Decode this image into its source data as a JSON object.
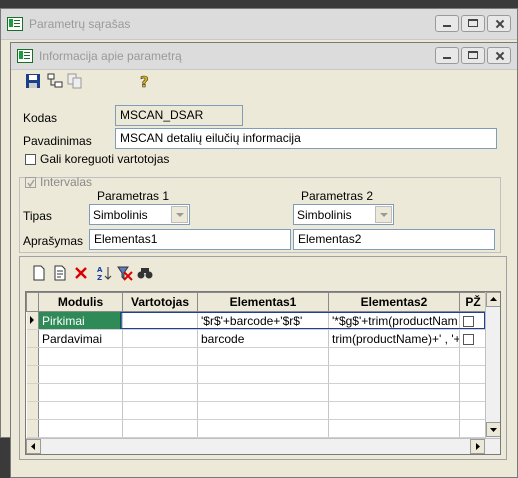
{
  "back_window": {
    "title": "Parametrų sąrašas"
  },
  "front_window": {
    "title": "Informacija apie parametrą"
  },
  "toolbar_icons": [
    "save-icon",
    "tree-icon",
    "copy-icon",
    "help-icon"
  ],
  "form": {
    "kodas_label": "Kodas",
    "kodas_value": "MSCAN_DSAR",
    "pavadinimas_label": "Pavadinimas",
    "pavadinimas_value": "MSCAN detalių eilučių informacija",
    "gali_koreguoti_label": "Gali koreguoti vartotojas",
    "intervalas_label": "Intervalas",
    "parametras1_label": "Parametras 1",
    "parametras2_label": "Parametras 2",
    "tipas_label": "Tipas",
    "tipas1_value": "Simbolinis",
    "tipas2_value": "Simbolinis",
    "aprasymas_label": "Aprašymas",
    "aprasymas1_value": "Elementas1",
    "aprasymas2_value": "Elementas2"
  },
  "grid_toolbar_icons": [
    "new-icon",
    "edit-icon",
    "delete-icon",
    "sort-az-icon",
    "filter-clear-icon",
    "find-icon"
  ],
  "grid": {
    "headers": [
      "Modulis",
      "Vartotojas",
      "Elementas1",
      "Elementas2",
      "PŽ"
    ],
    "rows": [
      {
        "modulis": "Pirkimai",
        "vartotojas": "",
        "elementas1": "'$r$'+barcode+'$r$'",
        "elementas2": "'*$g$'+trim(productNam"
      },
      {
        "modulis": "Pardavimai",
        "vartotojas": "",
        "elementas1": "barcode",
        "elementas2": "trim(productName)+' , '+"
      }
    ]
  },
  "colors": {
    "selection": "#2e8b57",
    "background": "#ece9d8"
  }
}
